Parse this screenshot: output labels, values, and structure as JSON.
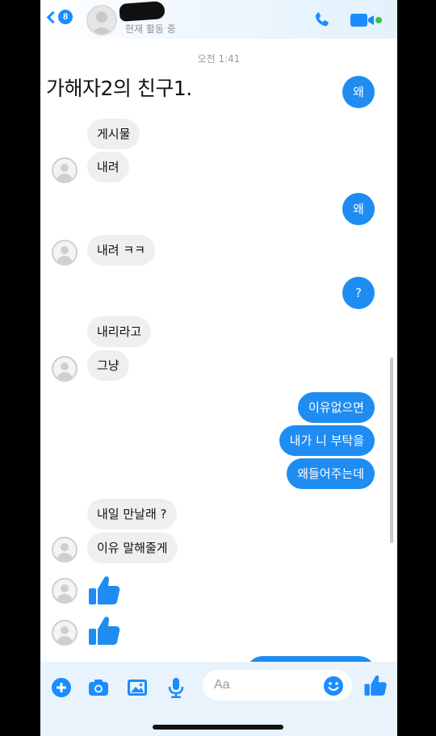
{
  "header": {
    "back_badge": "8",
    "status": "현재 활동 중",
    "accent": "#1a8cff"
  },
  "conversation": {
    "timestamp": "오전 1:41",
    "overlay_caption": "가해자2의 친구1.",
    "messages": [
      {
        "from": "me",
        "text": "왜"
      },
      {
        "from": "them",
        "text": "게시물"
      },
      {
        "from": "them",
        "text": "내려"
      },
      {
        "from": "me",
        "text": "왜"
      },
      {
        "from": "them",
        "text": "내려 ㅋㅋ"
      },
      {
        "from": "me",
        "text": "?"
      },
      {
        "from": "them",
        "text": "내리라고"
      },
      {
        "from": "them",
        "text": "그냥"
      },
      {
        "from": "me",
        "text": "이유없으면"
      },
      {
        "from": "me",
        "text": "내가 니 부탁을"
      },
      {
        "from": "me",
        "text": "왜들어주는데"
      },
      {
        "from": "them",
        "text": "내일 만날래 ?"
      },
      {
        "from": "them",
        "text": "이유 말해줄게"
      },
      {
        "from": "them",
        "icon": "thumbs-up-icon"
      },
      {
        "from": "them",
        "icon": "thumbs-up-icon"
      }
    ]
  },
  "composer": {
    "placeholder": "Aa",
    "icons": [
      "plus-icon",
      "camera-icon",
      "image-icon",
      "microphone-icon",
      "emoji-icon",
      "thumbs-up-icon"
    ]
  },
  "colors": {
    "outgoing_bubble": "#1f8cf2",
    "incoming_bubble": "#efefef"
  }
}
